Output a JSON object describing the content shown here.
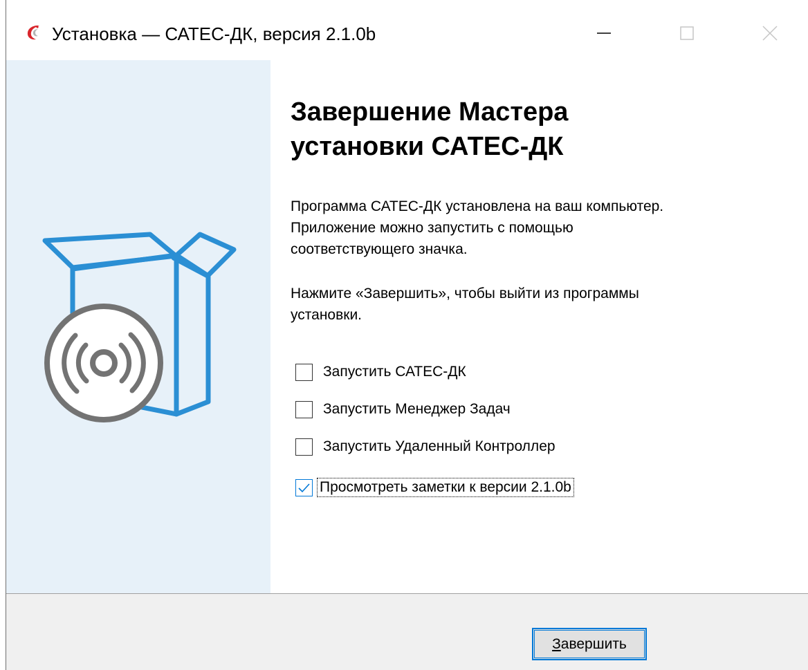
{
  "window": {
    "title": "Установка — САТЕС-ДК, версия 2.1.0b",
    "icons": {
      "app": "app-logo-icon",
      "minimize": "minimize-icon",
      "maximize": "maximize-icon",
      "close": "close-icon"
    }
  },
  "sidebar": {
    "art_icon": "software-box-disc-icon",
    "accent": "#2b8fd4",
    "disc_color": "#737373"
  },
  "main": {
    "heading": {
      "line1": "Завершение Мастера",
      "line2": "установки САТЕС-ДК"
    },
    "paragraph1": {
      "line1": "Программа САТЕС-ДК установлена на ваш компьютер.",
      "line2": "Приложение можно запустить с помощью",
      "line3": "соответствующего значка."
    },
    "paragraph2": {
      "line1": "Нажмите «Завершить», чтобы выйти из программы",
      "line2": "установки."
    },
    "options": [
      {
        "label": "Запустить САТЕС-ДК",
        "checked": false
      },
      {
        "label": "Запустить Менеджер Задач",
        "checked": false
      },
      {
        "label": "Запустить Удаленный Контроллер",
        "checked": false
      },
      {
        "label": "Просмотреть заметки к версии 2.1.0b",
        "checked": true
      }
    ]
  },
  "footer": {
    "finish_button": {
      "mnemonic": "З",
      "rest": "авершить"
    }
  },
  "colors": {
    "accent": "#0078d7",
    "sidebar_bg": "#e7f1f9",
    "footer_bg": "#f0f0f0"
  }
}
